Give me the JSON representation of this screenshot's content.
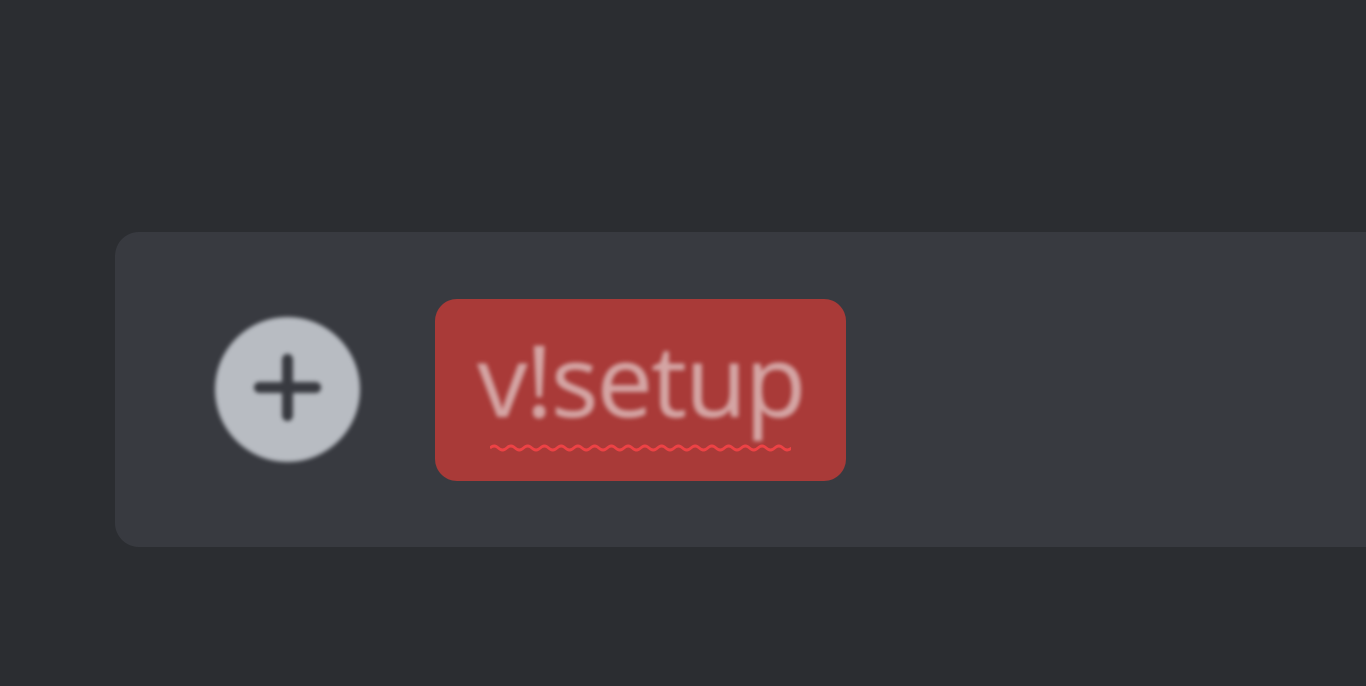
{
  "messageInput": {
    "text": "v!setup",
    "attachIcon": "plus-icon"
  }
}
